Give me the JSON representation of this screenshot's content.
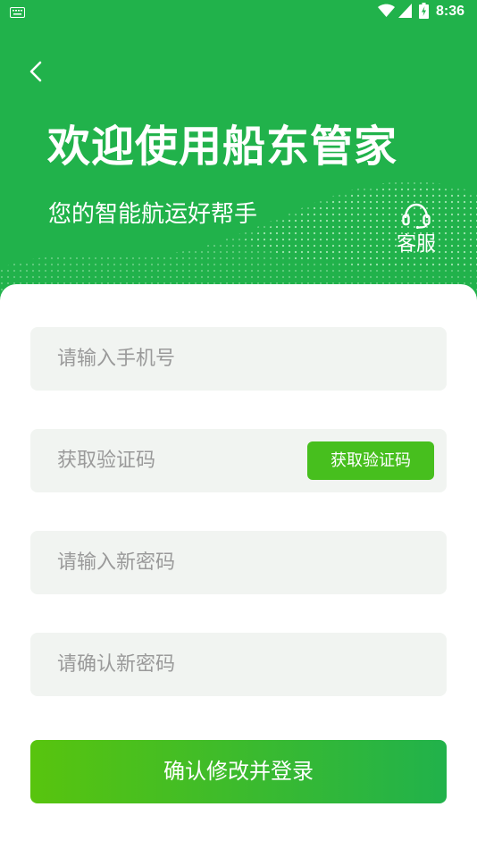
{
  "status_bar": {
    "time": "8:36",
    "icons": [
      "keyboard-icon",
      "wifi-icon",
      "signal-icon",
      "battery-charging-icon"
    ]
  },
  "header": {
    "back_icon": "chevron-left-icon",
    "title": "欢迎使用船东管家",
    "subtitle": "您的智能航运好帮手",
    "service": {
      "icon": "headset-icon",
      "label": "客服"
    }
  },
  "form": {
    "phone_placeholder": "请输入手机号",
    "code_placeholder": "获取验证码",
    "get_code_label": "获取验证码",
    "new_password_placeholder": "请输入新密码",
    "confirm_password_placeholder": "请确认新密码",
    "submit_label": "确认修改并登录"
  },
  "colors": {
    "brand_green": "#21b24b",
    "button_green": "#47bf1e",
    "gradient_start": "#58c40e",
    "field_bg": "#f1f4f1",
    "placeholder": "#9a9a9a"
  }
}
